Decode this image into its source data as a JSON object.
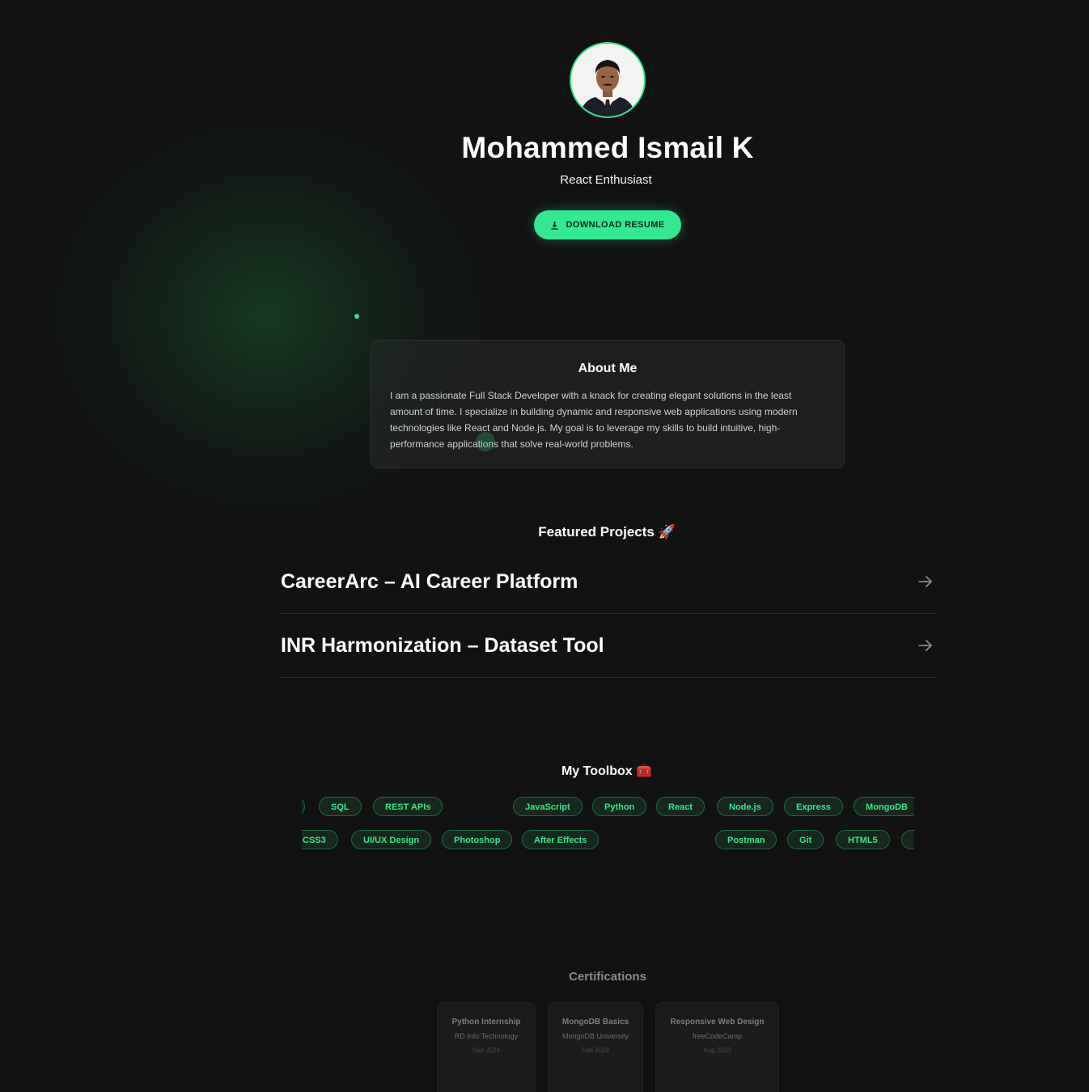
{
  "hero": {
    "name": "Mohammed Ismail K",
    "role": "React Enthusiast",
    "resume_button_label": "DOWNLOAD RESUME"
  },
  "about": {
    "title": "About Me",
    "text": "I am a passionate Full Stack Developer with a knack for creating elegant solutions in the least amount of time. I specialize in building dynamic and responsive web applications using modern technologies like React and Node.js. My goal is to leverage my skills to build intuitive, high-performance applications that solve real-world problems."
  },
  "projects": {
    "heading": "Featured Projects 🚀",
    "items": [
      {
        "title": "CareerArc – AI Career Platform"
      },
      {
        "title": "INR Harmonization – Dataset Tool"
      }
    ]
  },
  "toolbox": {
    "heading": "My Toolbox 🧰",
    "row1": [
      "SQL",
      "REST APIs",
      "JavaScript",
      "Python",
      "React",
      "Node.js",
      "Express",
      "MongoDB"
    ],
    "row2": [
      "CSS3",
      "UI/UX Design",
      "Photoshop",
      "After Effects",
      "Postman",
      "Git",
      "HTML5"
    ]
  },
  "certifications": {
    "heading": "Certifications",
    "items": [
      {
        "title": "Python Internship",
        "issuer": "RD Info Technology",
        "date": "Sep 2024"
      },
      {
        "title": "MongoDB Basics",
        "issuer": "MongoDB University",
        "date": "Feb 2024"
      },
      {
        "title": "Responsive Web Design",
        "issuer": "freeCodeCamp",
        "date": "Aug 2023"
      }
    ]
  },
  "theme": {
    "accent": "#33e890",
    "background": "#121212",
    "chip_text": "#35e58e"
  },
  "icons": {
    "download": "download-icon",
    "project_link": "arrow-right-icon"
  }
}
